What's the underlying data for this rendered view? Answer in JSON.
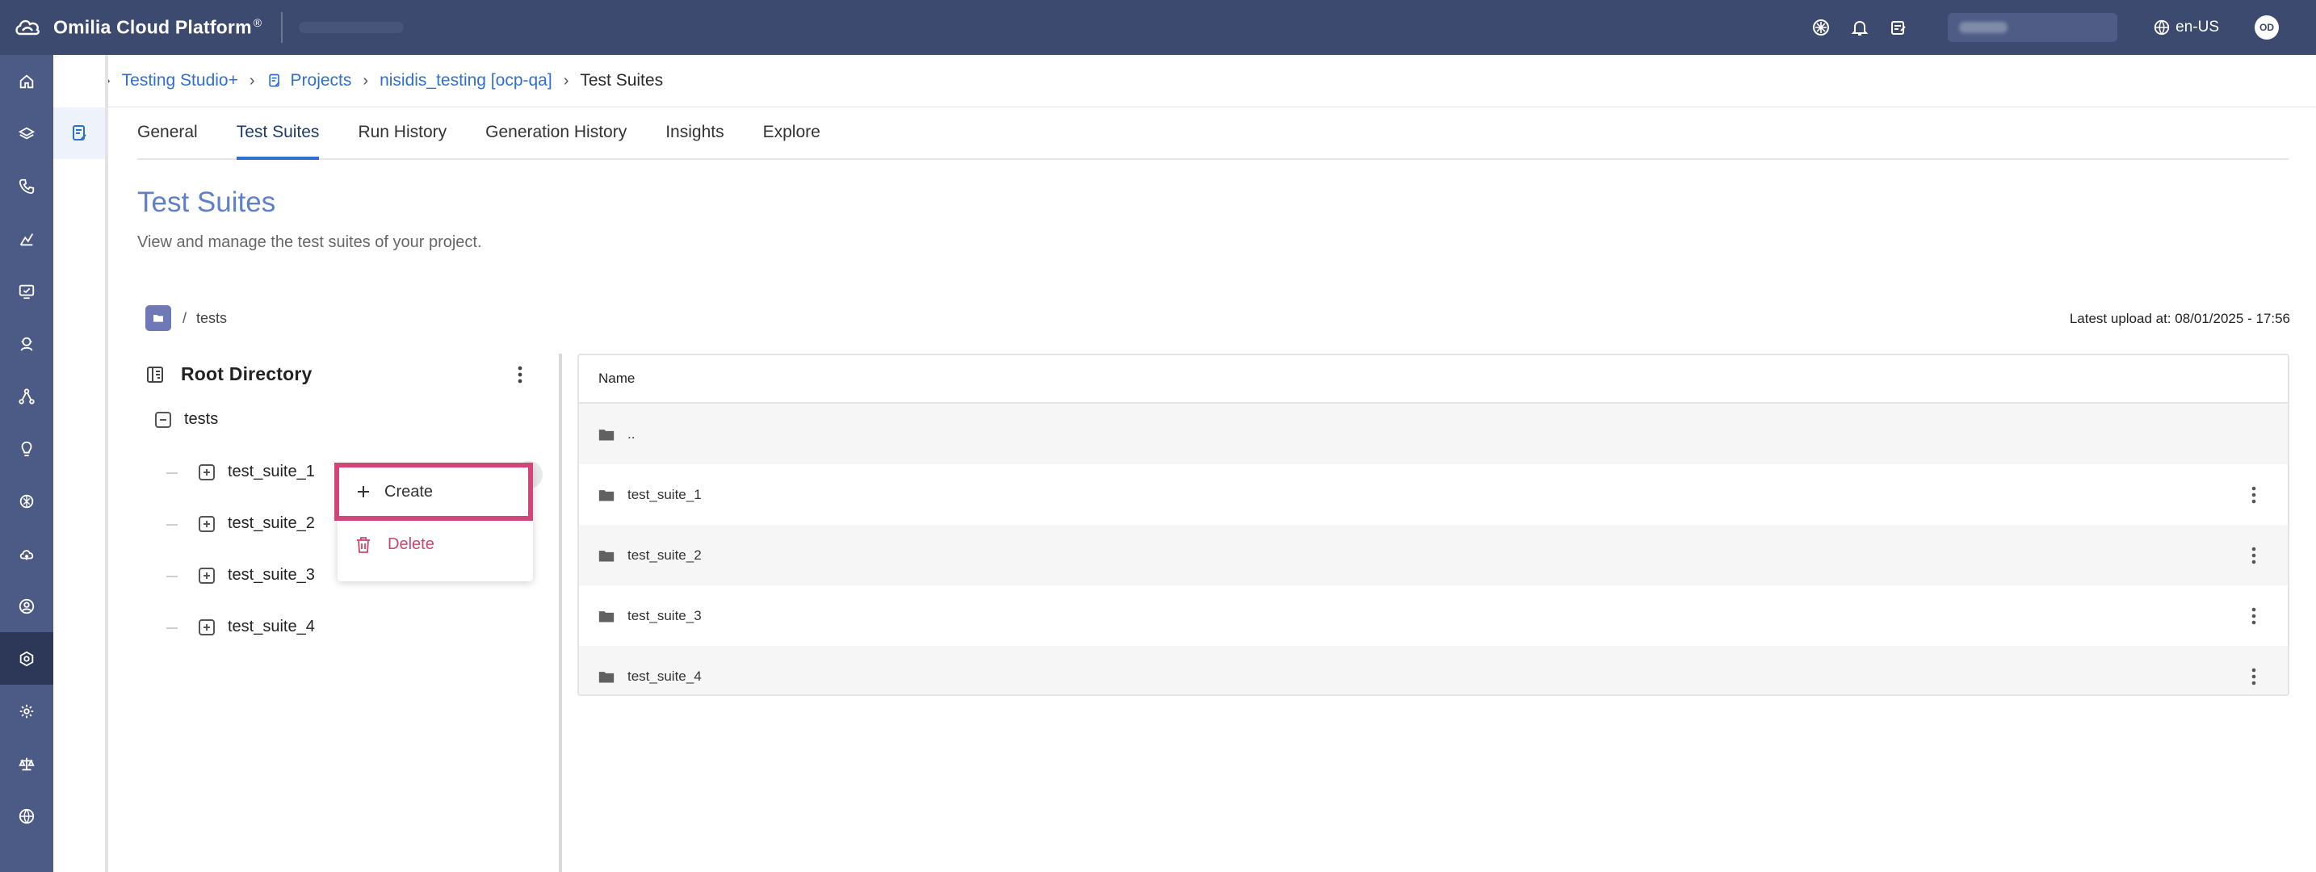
{
  "topbar": {
    "brand": "Omilia Cloud Platform",
    "brand_mark": "®",
    "language": "en-US",
    "user_initials": "OD"
  },
  "breadcrumb": {
    "items": [
      "Testing Studio+",
      "Projects",
      "nisidis_testing [ocp-qa]"
    ],
    "current": "Test Suites"
  },
  "tabs": [
    {
      "label": "General"
    },
    {
      "label": "Test Suites"
    },
    {
      "label": "Run History"
    },
    {
      "label": "Generation History"
    },
    {
      "label": "Insights"
    },
    {
      "label": "Explore"
    }
  ],
  "page": {
    "title": "Test Suites",
    "subtitle": "View and manage the test suites of your project.",
    "path_separator": "/",
    "path_current": "tests",
    "latest_upload": "Latest upload at: 08/01/2025 - 17:56"
  },
  "tree": {
    "root_label": "Root Directory",
    "folder": "tests",
    "children": [
      "test_suite_1",
      "test_suite_2",
      "test_suite_3",
      "test_suite_4"
    ]
  },
  "context_menu": {
    "create_label": "Create",
    "delete_label": "Delete"
  },
  "table": {
    "header_name": "Name",
    "parent_label": "..",
    "rows": [
      "test_suite_1",
      "test_suite_2",
      "test_suite_3",
      "test_suite_4"
    ]
  },
  "colors": {
    "topbar": "#3d4a70",
    "sidebar": "#4c5a86",
    "accent_link": "#2f6fd1",
    "highlight_border": "#d0467a",
    "delete": "#d0466a"
  },
  "sidebar_icons": [
    "home-icon",
    "layers-icon",
    "phone-icon",
    "analytics-icon",
    "monitor-icon",
    "agent-icon",
    "flow-icon",
    "bulb-icon",
    "brain-icon",
    "cloud-icon",
    "user-circle-icon",
    "hexagon-icon",
    "settings-icon",
    "scale-icon",
    "globe-icon"
  ]
}
